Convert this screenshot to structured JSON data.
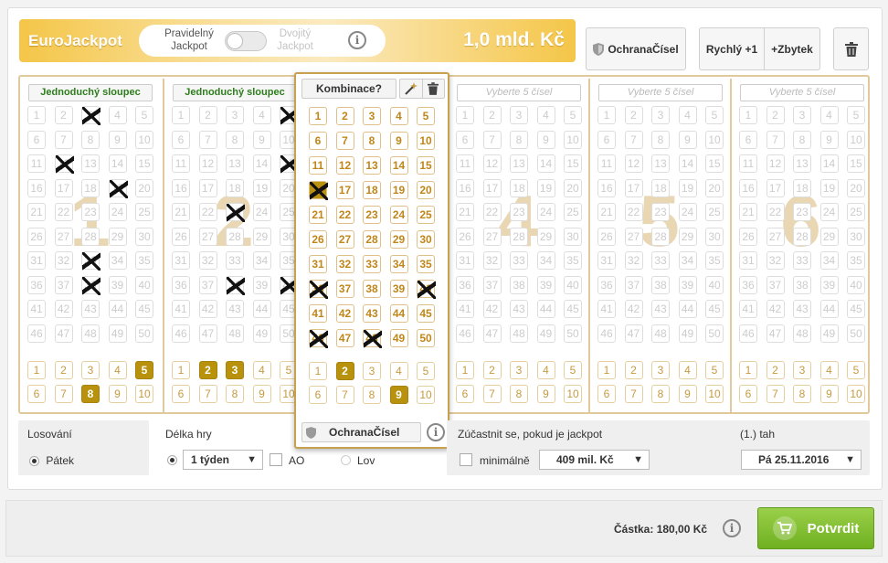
{
  "header": {
    "brand": "EuroJackpot",
    "jackpot_regular": "Pravidelný Jackpot",
    "jackpot_double": "Dvojitý Jackpot",
    "jackpot_amount": "1,0 mld. Kč",
    "protection_label": "OchranaČísel",
    "quick_label": "Rychlý +1",
    "remainder_label": "+Zbytek"
  },
  "panels": [
    {
      "number": "1",
      "button": "Jednoduchý sloupec",
      "button_style": "active",
      "main_selected": [
        3,
        12,
        19,
        33,
        38
      ],
      "euro_selected": [
        5,
        8
      ]
    },
    {
      "number": "2",
      "button": "Jednoduchý sloupec",
      "button_style": "active",
      "main_selected": [
        5,
        15,
        23,
        38,
        40
      ],
      "euro_selected": [
        2,
        3
      ]
    },
    {
      "number": "3",
      "button": "Kombinace?",
      "button_style": "combo",
      "main_selected": [
        16,
        36,
        40,
        46,
        48
      ],
      "euro_selected": [
        2,
        9
      ]
    },
    {
      "number": "4",
      "button": "Vyberte 5 čísel",
      "button_style": "empty",
      "main_selected": [],
      "euro_selected": []
    },
    {
      "number": "5",
      "button": "Vyberte 5 čísel",
      "button_style": "empty",
      "main_selected": [],
      "euro_selected": []
    },
    {
      "number": "6",
      "button": "Vyberte 5 čísel",
      "button_style": "empty",
      "main_selected": [],
      "euro_selected": []
    }
  ],
  "combo": {
    "title": "Kombinace?",
    "protection_label": "OchranaČísel"
  },
  "draw": {
    "label": "Losování",
    "day": "Pátek"
  },
  "duration": {
    "label": "Délka hry",
    "selected": "1 týden",
    "ao_label": "AO",
    "lov_label": "Lov"
  },
  "jackpot_condition": {
    "label": "Zúčastnit se, pokud je jackpot",
    "min_label": "minimálně",
    "amount": "409 mil. Kč"
  },
  "tah": {
    "label": "(1.) tah",
    "date": "Pá 25.11.2016"
  },
  "footer": {
    "sum_label": "Částka: 180,00 Kč",
    "confirm_label": "Potvrdit"
  },
  "colors": {
    "gold": "#b8920d",
    "number": "#c0861a",
    "confirm": "#7dbb2a"
  },
  "icons": {
    "shield": "shield-icon",
    "info": "info-icon",
    "trash": "trash-icon",
    "wand": "magic-wand-icon",
    "cart": "cart-icon"
  }
}
